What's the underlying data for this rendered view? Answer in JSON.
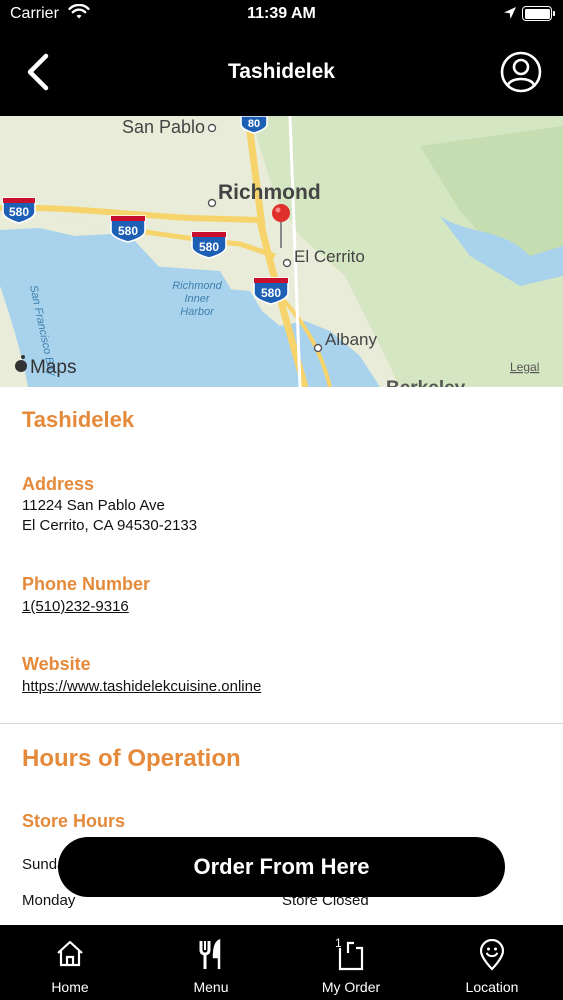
{
  "status_bar": {
    "carrier": "Carrier",
    "time": "11:39 AM"
  },
  "nav": {
    "title": "Tashidelek"
  },
  "map": {
    "labels": {
      "san_pablo": "San Pablo",
      "richmond": "Richmond",
      "el_cerrito": "El Cerrito",
      "albany": "Albany",
      "berkeley": "Berkeley",
      "richmond_inner_harbor_1": "Richmond",
      "richmond_inner_harbor_2": "Inner",
      "richmond_inner_harbor_3": "Harbor",
      "san_francisco_bay": "San Francisco Bay",
      "attribution": "Maps",
      "legal": "Legal"
    },
    "shields": {
      "i80": "80",
      "i580": "580"
    }
  },
  "store": {
    "name": "Tashidelek",
    "address_label": "Address",
    "address_line1": "11224 San Pablo Ave",
    "address_line2": "El Cerrito, CA 94530-2133",
    "phone_label": "Phone Number",
    "phone": "1(510)232-9316",
    "website_label": "Website",
    "website": "https://www.tashidelekcuisine.online"
  },
  "hours": {
    "title": "Hours of Operation",
    "store_hours_label": "Store Hours",
    "rows": [
      {
        "day": "Sunday",
        "hours": ""
      },
      {
        "day": "Monday",
        "hours": "Store Closed"
      }
    ]
  },
  "order_button": "Order From Here",
  "tabs": [
    {
      "label": "Home",
      "icon": "home-icon"
    },
    {
      "label": "Menu",
      "icon": "fork-knife-icon"
    },
    {
      "label": "My Order",
      "icon": "shopping-bag-icon",
      "badge": "1"
    },
    {
      "label": "Location",
      "icon": "location-pin-icon"
    }
  ],
  "colors": {
    "accent": "#e58a3a",
    "bar": "#000000",
    "link": "#111111"
  }
}
